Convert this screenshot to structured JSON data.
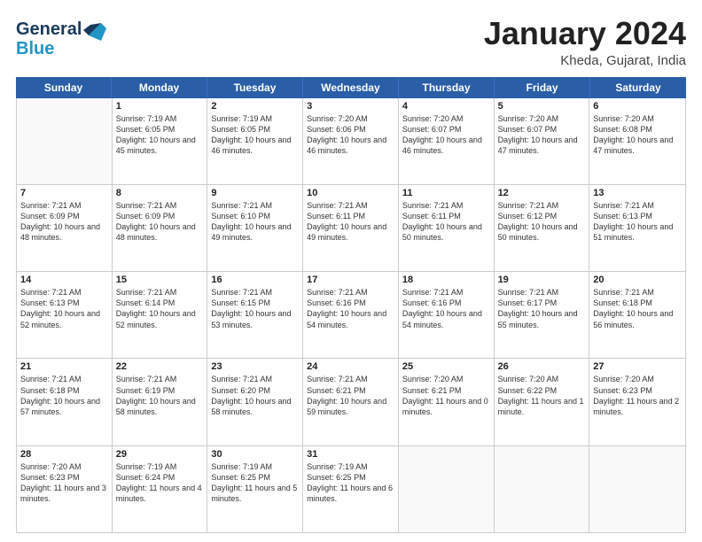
{
  "logo": {
    "text1": "General",
    "text2": "Blue"
  },
  "title": "January 2024",
  "location": "Kheda, Gujarat, India",
  "header_days": [
    "Sunday",
    "Monday",
    "Tuesday",
    "Wednesday",
    "Thursday",
    "Friday",
    "Saturday"
  ],
  "weeks": [
    [
      {
        "day": "",
        "sunrise": "",
        "sunset": "",
        "daylight": "",
        "empty": true
      },
      {
        "day": "1",
        "sunrise": "Sunrise: 7:19 AM",
        "sunset": "Sunset: 6:05 PM",
        "daylight": "Daylight: 10 hours and 45 minutes.",
        "empty": false
      },
      {
        "day": "2",
        "sunrise": "Sunrise: 7:19 AM",
        "sunset": "Sunset: 6:05 PM",
        "daylight": "Daylight: 10 hours and 46 minutes.",
        "empty": false
      },
      {
        "day": "3",
        "sunrise": "Sunrise: 7:20 AM",
        "sunset": "Sunset: 6:06 PM",
        "daylight": "Daylight: 10 hours and 46 minutes.",
        "empty": false
      },
      {
        "day": "4",
        "sunrise": "Sunrise: 7:20 AM",
        "sunset": "Sunset: 6:07 PM",
        "daylight": "Daylight: 10 hours and 46 minutes.",
        "empty": false
      },
      {
        "day": "5",
        "sunrise": "Sunrise: 7:20 AM",
        "sunset": "Sunset: 6:07 PM",
        "daylight": "Daylight: 10 hours and 47 minutes.",
        "empty": false
      },
      {
        "day": "6",
        "sunrise": "Sunrise: 7:20 AM",
        "sunset": "Sunset: 6:08 PM",
        "daylight": "Daylight: 10 hours and 47 minutes.",
        "empty": false
      }
    ],
    [
      {
        "day": "7",
        "sunrise": "Sunrise: 7:21 AM",
        "sunset": "Sunset: 6:09 PM",
        "daylight": "Daylight: 10 hours and 48 minutes.",
        "empty": false
      },
      {
        "day": "8",
        "sunrise": "Sunrise: 7:21 AM",
        "sunset": "Sunset: 6:09 PM",
        "daylight": "Daylight: 10 hours and 48 minutes.",
        "empty": false
      },
      {
        "day": "9",
        "sunrise": "Sunrise: 7:21 AM",
        "sunset": "Sunset: 6:10 PM",
        "daylight": "Daylight: 10 hours and 49 minutes.",
        "empty": false
      },
      {
        "day": "10",
        "sunrise": "Sunrise: 7:21 AM",
        "sunset": "Sunset: 6:11 PM",
        "daylight": "Daylight: 10 hours and 49 minutes.",
        "empty": false
      },
      {
        "day": "11",
        "sunrise": "Sunrise: 7:21 AM",
        "sunset": "Sunset: 6:11 PM",
        "daylight": "Daylight: 10 hours and 50 minutes.",
        "empty": false
      },
      {
        "day": "12",
        "sunrise": "Sunrise: 7:21 AM",
        "sunset": "Sunset: 6:12 PM",
        "daylight": "Daylight: 10 hours and 50 minutes.",
        "empty": false
      },
      {
        "day": "13",
        "sunrise": "Sunrise: 7:21 AM",
        "sunset": "Sunset: 6:13 PM",
        "daylight": "Daylight: 10 hours and 51 minutes.",
        "empty": false
      }
    ],
    [
      {
        "day": "14",
        "sunrise": "Sunrise: 7:21 AM",
        "sunset": "Sunset: 6:13 PM",
        "daylight": "Daylight: 10 hours and 52 minutes.",
        "empty": false
      },
      {
        "day": "15",
        "sunrise": "Sunrise: 7:21 AM",
        "sunset": "Sunset: 6:14 PM",
        "daylight": "Daylight: 10 hours and 52 minutes.",
        "empty": false
      },
      {
        "day": "16",
        "sunrise": "Sunrise: 7:21 AM",
        "sunset": "Sunset: 6:15 PM",
        "daylight": "Daylight: 10 hours and 53 minutes.",
        "empty": false
      },
      {
        "day": "17",
        "sunrise": "Sunrise: 7:21 AM",
        "sunset": "Sunset: 6:16 PM",
        "daylight": "Daylight: 10 hours and 54 minutes.",
        "empty": false
      },
      {
        "day": "18",
        "sunrise": "Sunrise: 7:21 AM",
        "sunset": "Sunset: 6:16 PM",
        "daylight": "Daylight: 10 hours and 54 minutes.",
        "empty": false
      },
      {
        "day": "19",
        "sunrise": "Sunrise: 7:21 AM",
        "sunset": "Sunset: 6:17 PM",
        "daylight": "Daylight: 10 hours and 55 minutes.",
        "empty": false
      },
      {
        "day": "20",
        "sunrise": "Sunrise: 7:21 AM",
        "sunset": "Sunset: 6:18 PM",
        "daylight": "Daylight: 10 hours and 56 minutes.",
        "empty": false
      }
    ],
    [
      {
        "day": "21",
        "sunrise": "Sunrise: 7:21 AM",
        "sunset": "Sunset: 6:18 PM",
        "daylight": "Daylight: 10 hours and 57 minutes.",
        "empty": false
      },
      {
        "day": "22",
        "sunrise": "Sunrise: 7:21 AM",
        "sunset": "Sunset: 6:19 PM",
        "daylight": "Daylight: 10 hours and 58 minutes.",
        "empty": false
      },
      {
        "day": "23",
        "sunrise": "Sunrise: 7:21 AM",
        "sunset": "Sunset: 6:20 PM",
        "daylight": "Daylight: 10 hours and 58 minutes.",
        "empty": false
      },
      {
        "day": "24",
        "sunrise": "Sunrise: 7:21 AM",
        "sunset": "Sunset: 6:21 PM",
        "daylight": "Daylight: 10 hours and 59 minutes.",
        "empty": false
      },
      {
        "day": "25",
        "sunrise": "Sunrise: 7:20 AM",
        "sunset": "Sunset: 6:21 PM",
        "daylight": "Daylight: 11 hours and 0 minutes.",
        "empty": false
      },
      {
        "day": "26",
        "sunrise": "Sunrise: 7:20 AM",
        "sunset": "Sunset: 6:22 PM",
        "daylight": "Daylight: 11 hours and 1 minute.",
        "empty": false
      },
      {
        "day": "27",
        "sunrise": "Sunrise: 7:20 AM",
        "sunset": "Sunset: 6:23 PM",
        "daylight": "Daylight: 11 hours and 2 minutes.",
        "empty": false
      }
    ],
    [
      {
        "day": "28",
        "sunrise": "Sunrise: 7:20 AM",
        "sunset": "Sunset: 6:23 PM",
        "daylight": "Daylight: 11 hours and 3 minutes.",
        "empty": false
      },
      {
        "day": "29",
        "sunrise": "Sunrise: 7:19 AM",
        "sunset": "Sunset: 6:24 PM",
        "daylight": "Daylight: 11 hours and 4 minutes.",
        "empty": false
      },
      {
        "day": "30",
        "sunrise": "Sunrise: 7:19 AM",
        "sunset": "Sunset: 6:25 PM",
        "daylight": "Daylight: 11 hours and 5 minutes.",
        "empty": false
      },
      {
        "day": "31",
        "sunrise": "Sunrise: 7:19 AM",
        "sunset": "Sunset: 6:25 PM",
        "daylight": "Daylight: 11 hours and 6 minutes.",
        "empty": false
      },
      {
        "day": "",
        "sunrise": "",
        "sunset": "",
        "daylight": "",
        "empty": true
      },
      {
        "day": "",
        "sunrise": "",
        "sunset": "",
        "daylight": "",
        "empty": true
      },
      {
        "day": "",
        "sunrise": "",
        "sunset": "",
        "daylight": "",
        "empty": true
      }
    ]
  ]
}
